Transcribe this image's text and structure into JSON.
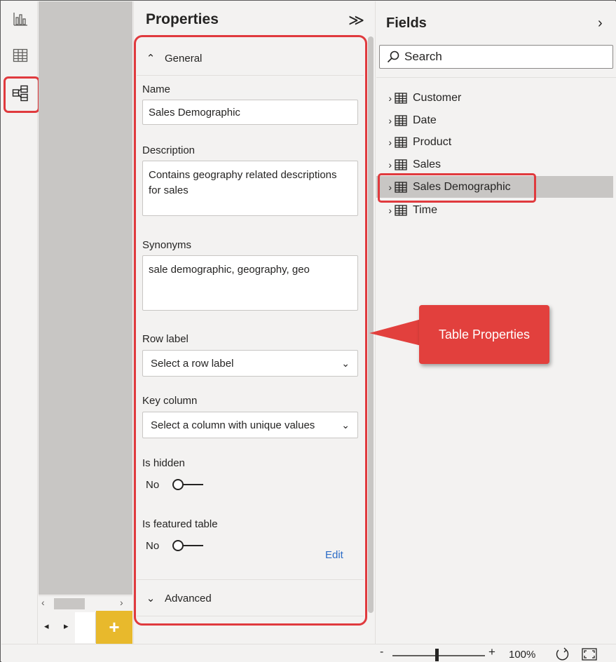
{
  "left_nav": {
    "items": [
      {
        "icon": "report-view-icon"
      },
      {
        "icon": "data-view-icon"
      },
      {
        "icon": "model-view-icon",
        "selected": true
      }
    ]
  },
  "canvas": {
    "hscroll_left": "‹",
    "hscroll_right": "›",
    "page_prev": "◂",
    "page_next": "▸",
    "add_page_label": "+"
  },
  "properties": {
    "title": "Properties",
    "collapse_glyph": "≫",
    "general": {
      "chevron": "⌃",
      "label": "General"
    },
    "name": {
      "label": "Name",
      "value": "Sales Demographic"
    },
    "description": {
      "label": "Description",
      "value": "Contains geography related descriptions for sales"
    },
    "synonyms": {
      "label": "Synonyms",
      "value": "sale demographic, geography, geo"
    },
    "row_label": {
      "label": "Row label",
      "selected": "Select a row label",
      "chevron": "⌄"
    },
    "key_column": {
      "label": "Key column",
      "selected": "Select a column with unique values",
      "chevron": "⌄"
    },
    "is_hidden": {
      "label": "Is hidden",
      "value": "No"
    },
    "is_featured": {
      "label": "Is featured table",
      "value": "No"
    },
    "edit_label": "Edit",
    "advanced": {
      "chevron": "⌄",
      "label": "Advanced"
    }
  },
  "callout": {
    "text": "Table Properties"
  },
  "fields": {
    "title": "Fields",
    "expand_glyph": "›",
    "search_placeholder": "Search",
    "items": [
      {
        "label": "Customer",
        "chevron": "›"
      },
      {
        "label": "Date",
        "chevron": "›"
      },
      {
        "label": "Product",
        "chevron": "›"
      },
      {
        "label": "Sales",
        "chevron": "›"
      },
      {
        "label": "Sales Demographic",
        "chevron": "›",
        "selected": true
      },
      {
        "label": "Time",
        "chevron": "›"
      }
    ]
  },
  "status": {
    "zoom_minus": "-",
    "zoom_plus": "+",
    "zoom_level": "100%"
  },
  "colors": {
    "highlight": "#e03a3e",
    "add_page": "#e8b92c",
    "link": "#2b6cc7",
    "pane_bg": "#f3f2f1"
  }
}
